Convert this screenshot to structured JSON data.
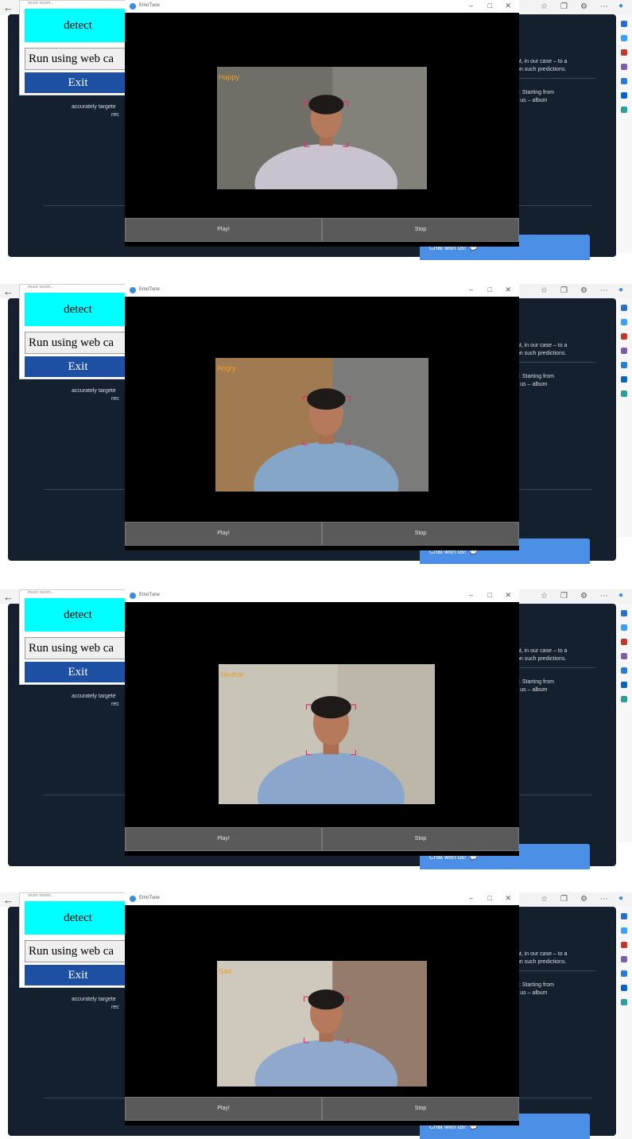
{
  "tk_window": {
    "detect_label": "detect",
    "run_label": "Run using web ca",
    "exit_label": "Exit",
    "title": "music recom..."
  },
  "video_window": {
    "title": "EmoTune",
    "play_label": "Play!",
    "stop_label": "Stop"
  },
  "browser_page": {
    "text_line1": "nt, in our case – to a",
    "text_line2": "on such predictions.",
    "text_line3": "y. Starting from",
    "text_line4": "r us – album",
    "left_text1": "accurately targete",
    "left_text2": "rec",
    "chat_label": "Chat with us!"
  },
  "frames": [
    {
      "emotion": "Happy",
      "subject": "woman-smiling"
    },
    {
      "emotion": "Angry",
      "subject": "man-window-background"
    },
    {
      "emotion": "Neutral",
      "subject": "man-glasses"
    },
    {
      "emotion": "Sad",
      "subject": "woman-neutral"
    }
  ],
  "colors": {
    "detect_bg": "#00ffff",
    "exit_bg": "#1d4fa3",
    "page_bg": "#15202e",
    "emotion_text": "#e8a020",
    "face_box": "#e0306a",
    "chat_bg": "#4c8fe6"
  },
  "icons": {
    "browser_back": "back-arrow-icon",
    "rail_icons": [
      "search-icon",
      "diamond-icon",
      "briefcase-icon",
      "people-icon",
      "office-icon",
      "outlook-icon",
      "send-icon"
    ],
    "toolbar": [
      "favorites-icon",
      "collections-icon",
      "extensions-icon",
      "more-icon",
      "profile-icon"
    ]
  }
}
